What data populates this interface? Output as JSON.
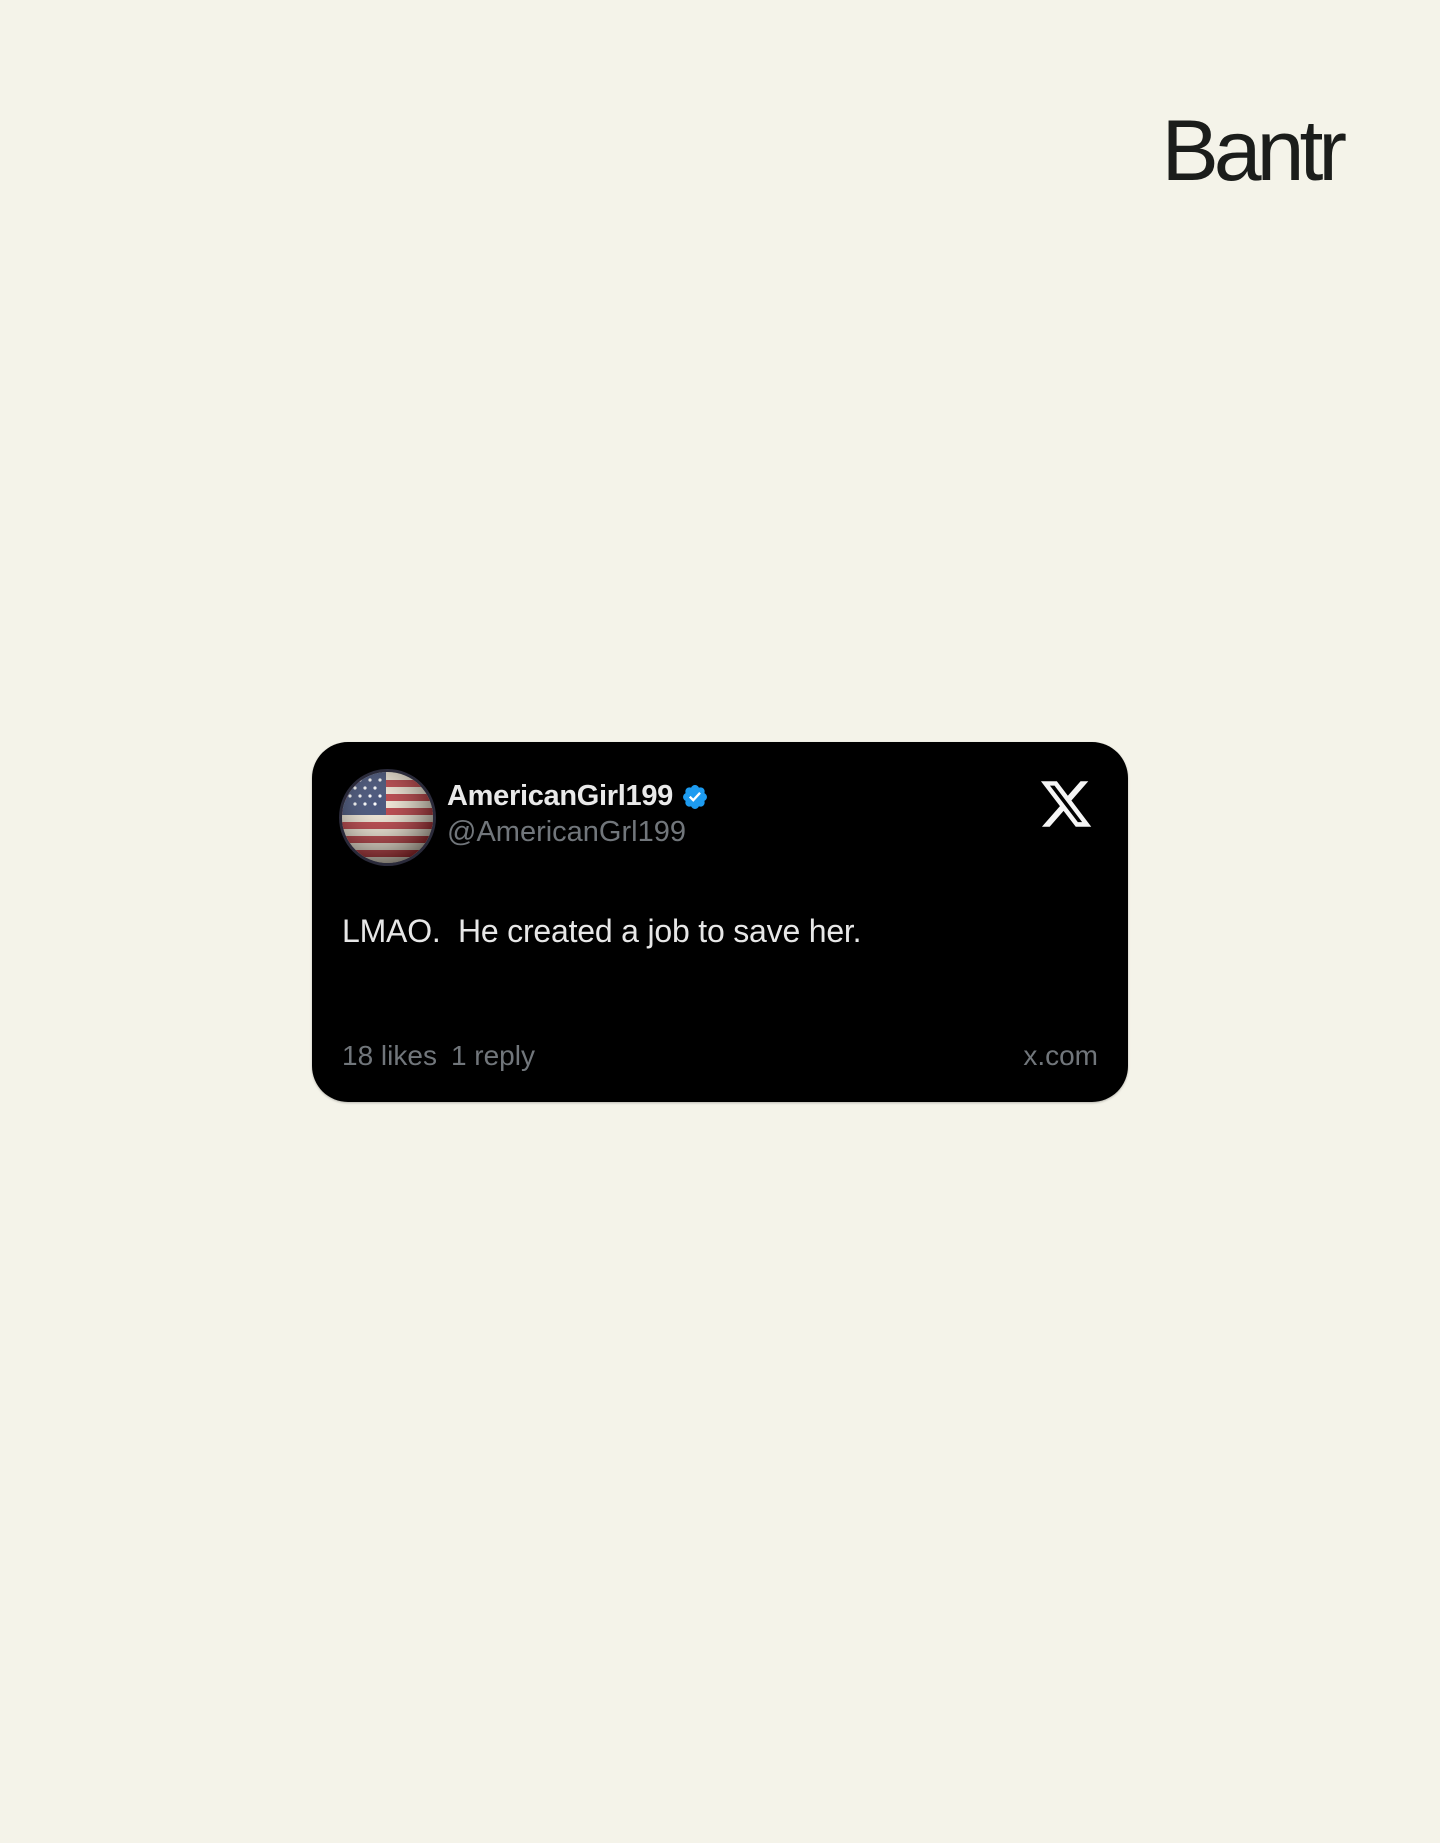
{
  "brand": {
    "name": "Bantr"
  },
  "post": {
    "display_name": "AmericanGirl199",
    "handle": "@AmericanGrl199",
    "verified": true,
    "text": "LMAO.  He created a job to save her.",
    "likes": "18 likes",
    "replies": "1 reply",
    "source": "x.com"
  },
  "icons": {
    "avatar": "american-flag-avatar",
    "verified": "verified-badge-icon",
    "platform": "x-logo-icon"
  },
  "colors": {
    "page_background": "#f4f3e9",
    "card_background": "#000000",
    "verified_blue": "#1d9bf0",
    "muted_text": "#71767b",
    "brand_text": "#1b1d1b"
  }
}
